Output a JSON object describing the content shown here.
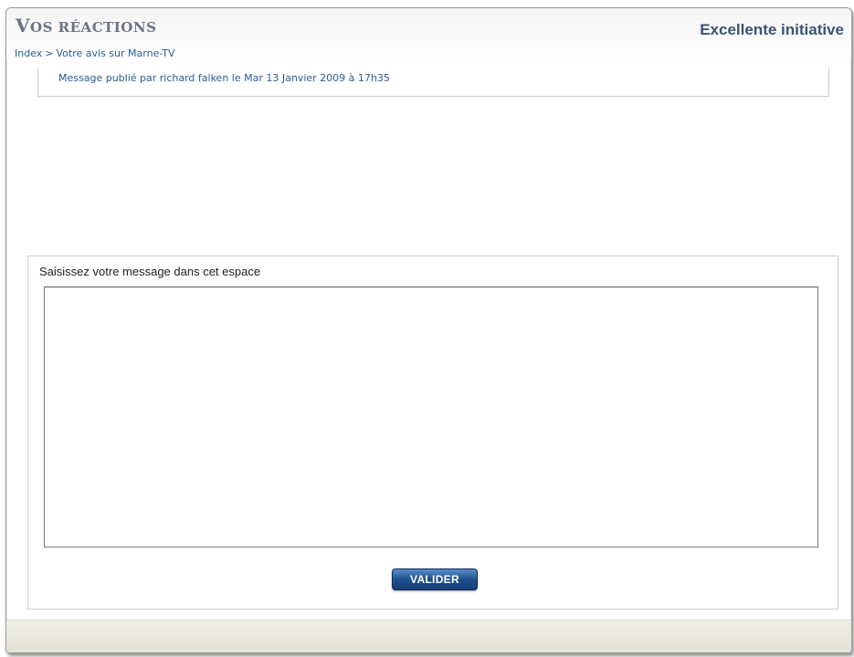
{
  "header": {
    "title_initial": "V",
    "title_rest": "OS RÉACTIONS",
    "topic_title": "Excellente initiative"
  },
  "breadcrumb": {
    "items": [
      {
        "label": "Index"
      },
      {
        "label": "Votre avis sur Marne-TV"
      }
    ],
    "separator": ">"
  },
  "post": {
    "meta": "Message publié par richard falken le Mar 13 Janvier 2009 à 17h35"
  },
  "reply_form": {
    "label": "Saisissez votre message dans cet espace",
    "message_value": "",
    "submit_label": "VALIDER"
  }
}
